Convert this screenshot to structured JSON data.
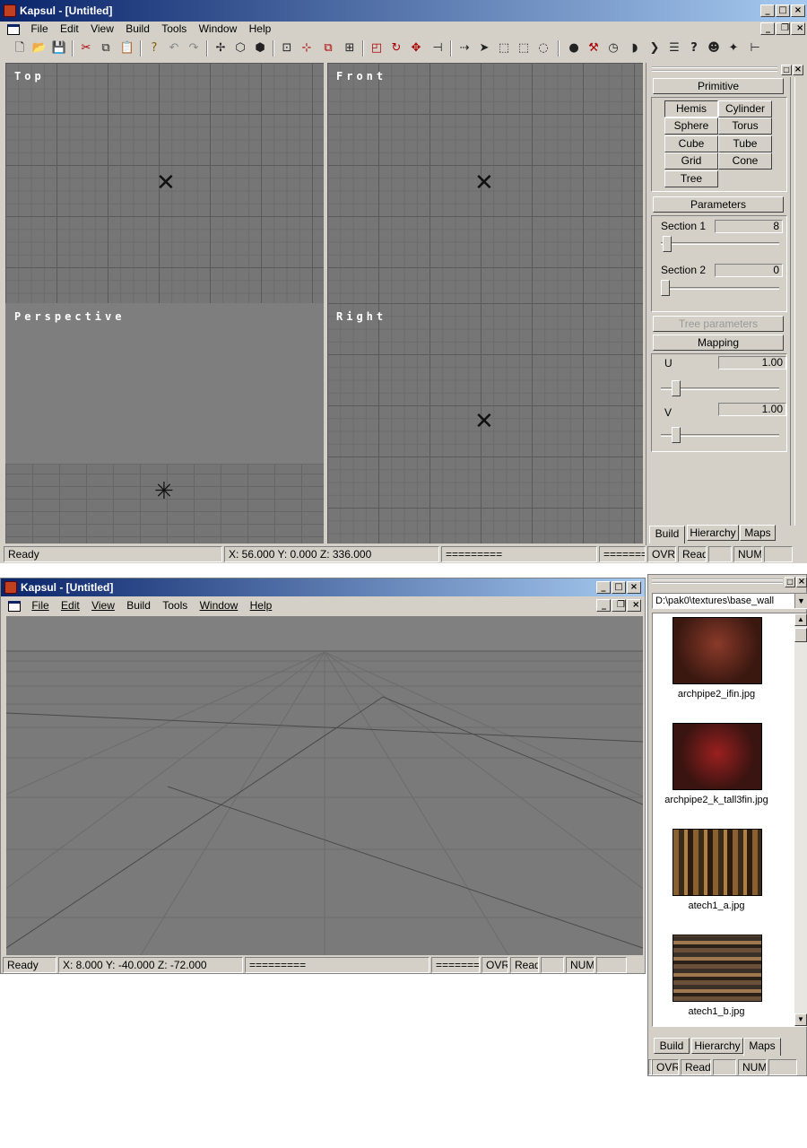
{
  "window1": {
    "title": "Kapsul - [Untitled]",
    "menu": [
      "File",
      "Edit",
      "View",
      "Build",
      "Tools",
      "Window",
      "Help"
    ],
    "viewports": {
      "top": "Top",
      "front": "Front",
      "perspective": "Perspective",
      "right": "Right"
    },
    "status": {
      "ready": "Ready",
      "coords": "X:  56.000 Y:   0.000 Z: 336.000",
      "bar1": "=========",
      "bar2": "========",
      "ovr": "OVR",
      "read": "Read",
      "num": "NUM"
    }
  },
  "build_panel": {
    "primitive_header": "Primitive",
    "primitives": [
      "Hemis",
      "Cylinder",
      "Sphere",
      "Torus",
      "Cube",
      "Tube",
      "Grid",
      "Cone",
      "Tree"
    ],
    "parameters_header": "Parameters",
    "section1_label": "Section 1",
    "section1_value": "8",
    "section2_label": "Section 2",
    "section2_value": "0",
    "tree_params_header": "Tree parameters",
    "mapping_header": "Mapping",
    "u_label": "U",
    "u_value": "1.00",
    "v_label": "V",
    "v_value": "1.00",
    "tabs": [
      "Build",
      "Hierarchy",
      "Maps"
    ]
  },
  "window2": {
    "title": "Kapsul - [Untitled]",
    "menu": [
      "File",
      "Edit",
      "View",
      "Build",
      "Tools",
      "Window",
      "Help"
    ],
    "status": {
      "ready": "Ready",
      "coords": "X:   8.000 Y: -40.000 Z: -72.000",
      "bar1": "=========",
      "bar2": "========",
      "ovr": "OVR",
      "read": "Read",
      "num": "NUM"
    }
  },
  "maps_panel": {
    "path": "D:\\pak0\\textures\\base_wall",
    "textures": [
      {
        "name": "archpipe2_ifin.jpg",
        "color": "#5a2a20"
      },
      {
        "name": "archpipe2_k_tall3fin.jpg",
        "color": "#4a1a18"
      },
      {
        "name": "atech1_a.jpg",
        "color": "#6a4a28"
      },
      {
        "name": "atech1_b.jpg",
        "color": "#5a4030"
      }
    ],
    "tabs": [
      "Build",
      "Hierarchy",
      "Maps"
    ],
    "status": {
      "ovr": "OVR",
      "read": "Read",
      "num": "NUM"
    }
  }
}
